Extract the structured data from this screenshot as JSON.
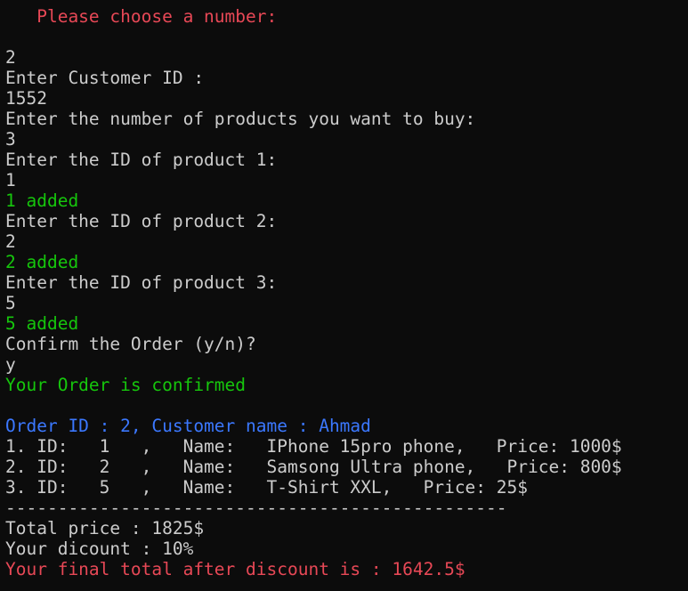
{
  "colors": {
    "background": "#0c0c0c",
    "default_text": "#cccccc",
    "red": "#e74856",
    "green": "#16c60c",
    "blue": "#3b78ff"
  },
  "lines": [
    {
      "text": "   Please choose a number:",
      "color": "red"
    },
    {
      "text": "",
      "color": "gray"
    },
    {
      "text": "2",
      "color": "gray"
    },
    {
      "text": "Enter Customer ID :",
      "color": "gray"
    },
    {
      "text": "1552",
      "color": "gray"
    },
    {
      "text": "Enter the number of products you want to buy:",
      "color": "gray"
    },
    {
      "text": "3",
      "color": "gray"
    },
    {
      "text": "Enter the ID of product 1:",
      "color": "gray"
    },
    {
      "text": "1",
      "color": "gray"
    },
    {
      "text": "1 added",
      "color": "green"
    },
    {
      "text": "Enter the ID of product 2:",
      "color": "gray"
    },
    {
      "text": "2",
      "color": "gray"
    },
    {
      "text": "2 added",
      "color": "green"
    },
    {
      "text": "Enter the ID of product 3:",
      "color": "gray"
    },
    {
      "text": "5",
      "color": "gray"
    },
    {
      "text": "5 added",
      "color": "green"
    },
    {
      "text": "Confirm the Order (y/n)?",
      "color": "gray"
    },
    {
      "text": "y",
      "color": "gray"
    },
    {
      "text": "Your Order is confirmed",
      "color": "green"
    },
    {
      "text": "",
      "color": "gray"
    },
    {
      "text": "Order ID : 2, Customer name : Ahmad",
      "color": "blue"
    },
    {
      "text": "1. ID:   1   ,   Name:   IPhone 15pro phone,   Price: 1000$",
      "color": "gray"
    },
    {
      "text": "2. ID:   2   ,   Name:   Samsong Ultra phone,   Price: 800$",
      "color": "gray"
    },
    {
      "text": "3. ID:   5   ,   Name:   T-Shirt XXL,   Price: 25$",
      "color": "gray"
    },
    {
      "text": "------------------------------------------------",
      "color": "gray"
    },
    {
      "text": "Total price : 1825$",
      "color": "gray"
    },
    {
      "text": "Your dicount : 10%",
      "color": "gray"
    },
    {
      "text": "Your final total after discount is : 1642.5$",
      "color": "red"
    }
  ]
}
